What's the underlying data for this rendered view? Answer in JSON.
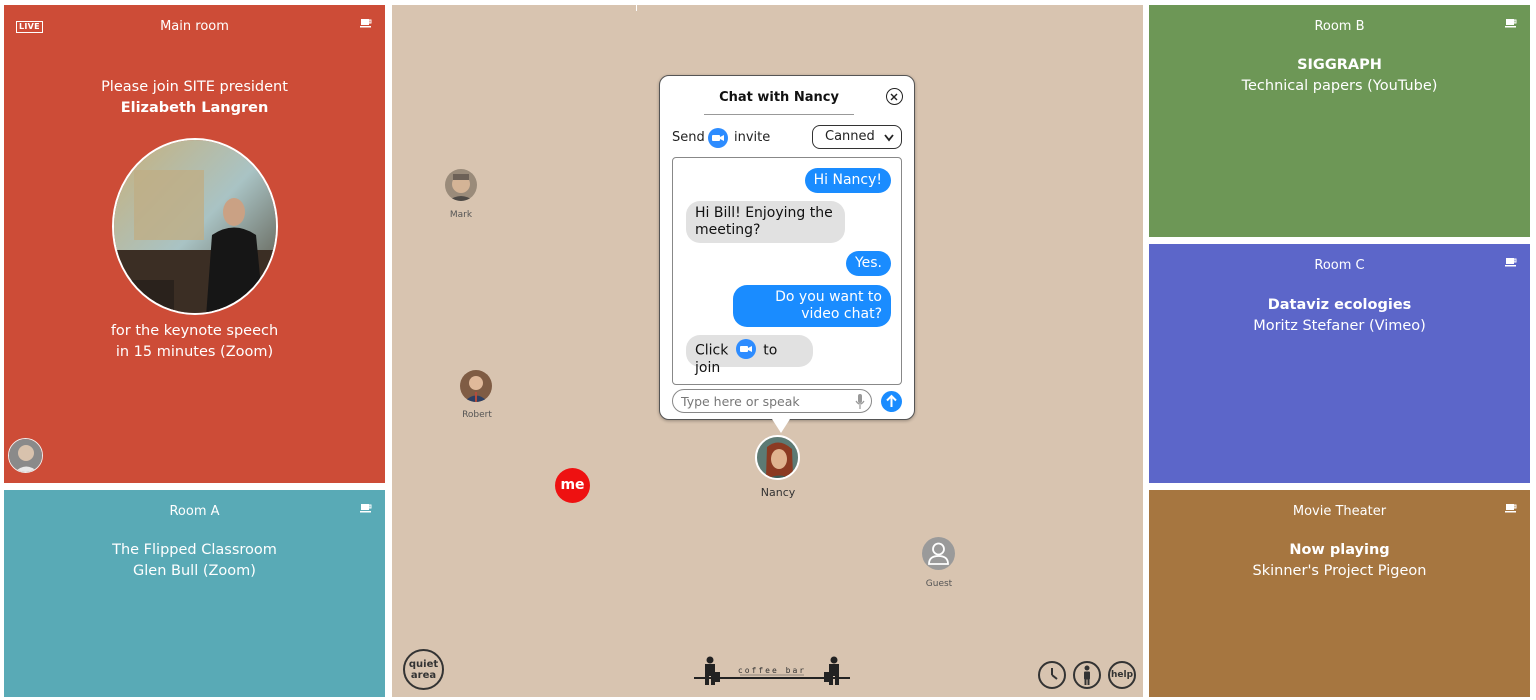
{
  "main_room": {
    "live_badge": "LIVE",
    "title": "Main room",
    "line1": "Please join SITE president",
    "line2": "Elizabeth Langren",
    "line3": "for the keynote speech",
    "line4": "in 15 minutes (Zoom)",
    "color": "#cd4c37"
  },
  "room_a": {
    "title": "Room A",
    "line1": "The Flipped Classroom",
    "line2": "Glen Bull (Zoom)",
    "color": "#59aab6"
  },
  "room_b": {
    "title": "Room B",
    "line1": "SIGGRAPH",
    "line2": "Technical papers (YouTube)",
    "color": "#6d9756"
  },
  "room_c": {
    "title": "Room C",
    "line1": "Dataviz ecologies",
    "line2": "Moritz Stefaner (Vimeo)",
    "color": "#5c66c9"
  },
  "movie": {
    "title": "Movie Theater",
    "line1": "Now playing",
    "line2": "Skinner's Project Pigeon",
    "color": "#a67640"
  },
  "lounge": {
    "color": "#d8c4b0",
    "people": [
      {
        "name": "Mark"
      },
      {
        "name": "Robert"
      },
      {
        "name": "Nancy"
      },
      {
        "name": "Guest"
      }
    ],
    "me_label": "me",
    "quiet_label_1": "quiet",
    "quiet_label_2": "area",
    "coffee_label": "coffee bar",
    "help_label": "help"
  },
  "chat": {
    "title": "Chat with Nancy",
    "send_label": "Send",
    "invite_label": "invite",
    "canned_label": "Canned",
    "messages": [
      {
        "from": "me",
        "text": "Hi Nancy!"
      },
      {
        "from": "them",
        "text": "Hi Bill! Enjoying the meeting?"
      },
      {
        "from": "me",
        "text": "Yes."
      },
      {
        "from": "me",
        "text": "Do you want to video chat?"
      },
      {
        "from": "them",
        "text_before": "Click",
        "text_after": "to join"
      }
    ],
    "input_placeholder": "Type here or speak",
    "accent": "#1a8cff"
  }
}
